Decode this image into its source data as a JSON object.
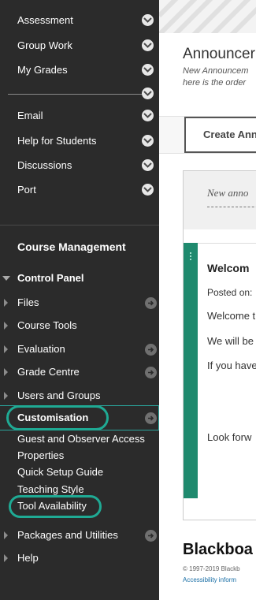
{
  "sidebar": {
    "top_items": [
      "Assessment",
      "Group Work",
      "My Grades"
    ],
    "tools_items": [
      "Email",
      "Help for Students",
      "Discussions",
      "Port"
    ],
    "course_management_title": "Course Management",
    "control_panel_title": "Control Panel",
    "control_panel_items": [
      "Files",
      "Course Tools",
      "Evaluation",
      "Grade Centre",
      "Users and Groups",
      "Customisation"
    ],
    "customisation_subitems": [
      "Guest and Observer Access",
      "Properties",
      "Quick Setup Guide",
      "Teaching Style",
      "Tool Availability"
    ],
    "bottom_items": [
      "Packages and Utilities",
      "Help"
    ],
    "highlight_color": "#1faa94"
  },
  "main": {
    "title": "Announcer",
    "description_line1": "New Announcem",
    "description_line2": "here is the order",
    "create_button_label": "Create Ann",
    "filter_text": "New anno",
    "item": {
      "title": "Welcom",
      "posted_on": "Posted on:",
      "lines": [
        "Welcome t",
        "We will be",
        "If you have",
        "Look forw"
      ]
    },
    "footer": {
      "logo_text": "Blackboa",
      "copyright": "© 1997-2019 Blackb",
      "accessibility_link": "Accessibility inform"
    }
  }
}
